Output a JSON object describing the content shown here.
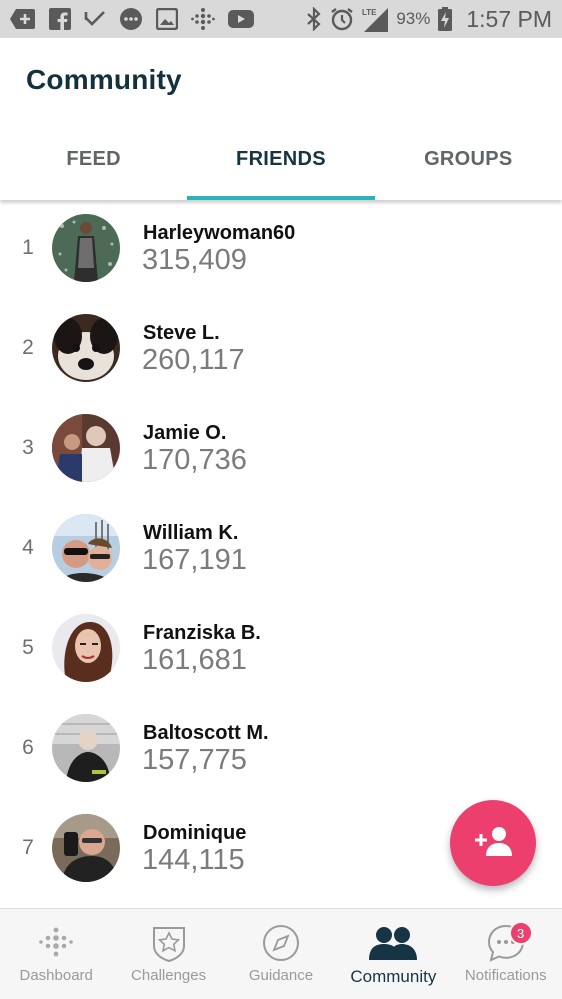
{
  "status_bar": {
    "icons": [
      "add-box-icon",
      "facebook-icon",
      "check-notification-icon",
      "message-icon",
      "image-icon",
      "fitbit-icon",
      "youtube-icon",
      "bluetooth-icon",
      "alarm-icon",
      "lte-signal-icon",
      "battery-charging-icon"
    ],
    "lte_label": "LTE",
    "battery": "93%",
    "time": "1:57 PM"
  },
  "header": {
    "title": "Community"
  },
  "tabs": [
    {
      "label": "FEED",
      "active": false
    },
    {
      "label": "FRIENDS",
      "active": true
    },
    {
      "label": "GROUPS",
      "active": false
    }
  ],
  "friends": [
    {
      "rank": "1",
      "name": "Harleywoman60",
      "steps": "315,409"
    },
    {
      "rank": "2",
      "name": "Steve L.",
      "steps": "260,117"
    },
    {
      "rank": "3",
      "name": "Jamie O.",
      "steps": "170,736"
    },
    {
      "rank": "4",
      "name": "William K.",
      "steps": "167,191"
    },
    {
      "rank": "5",
      "name": "Franziska B.",
      "steps": "161,681"
    },
    {
      "rank": "6",
      "name": "Baltoscott M.",
      "steps": "157,775"
    },
    {
      "rank": "7",
      "name": "Dominique",
      "steps": "144,115"
    }
  ],
  "fab": {
    "icon": "add-friend-icon"
  },
  "bottom_nav": [
    {
      "label": "Dashboard",
      "icon": "dashboard-dots-icon",
      "active": false
    },
    {
      "label": "Challenges",
      "icon": "star-shield-icon",
      "active": false
    },
    {
      "label": "Guidance",
      "icon": "compass-icon",
      "active": false
    },
    {
      "label": "Community",
      "icon": "people-icon",
      "active": true
    },
    {
      "label": "Notifications",
      "icon": "chat-bubble-icon",
      "active": false,
      "badge": "3"
    }
  ],
  "colors": {
    "accent": "#2bb3b9",
    "fab": "#ec3f6e",
    "title": "#13303d",
    "badge": "#ec3f6e"
  }
}
